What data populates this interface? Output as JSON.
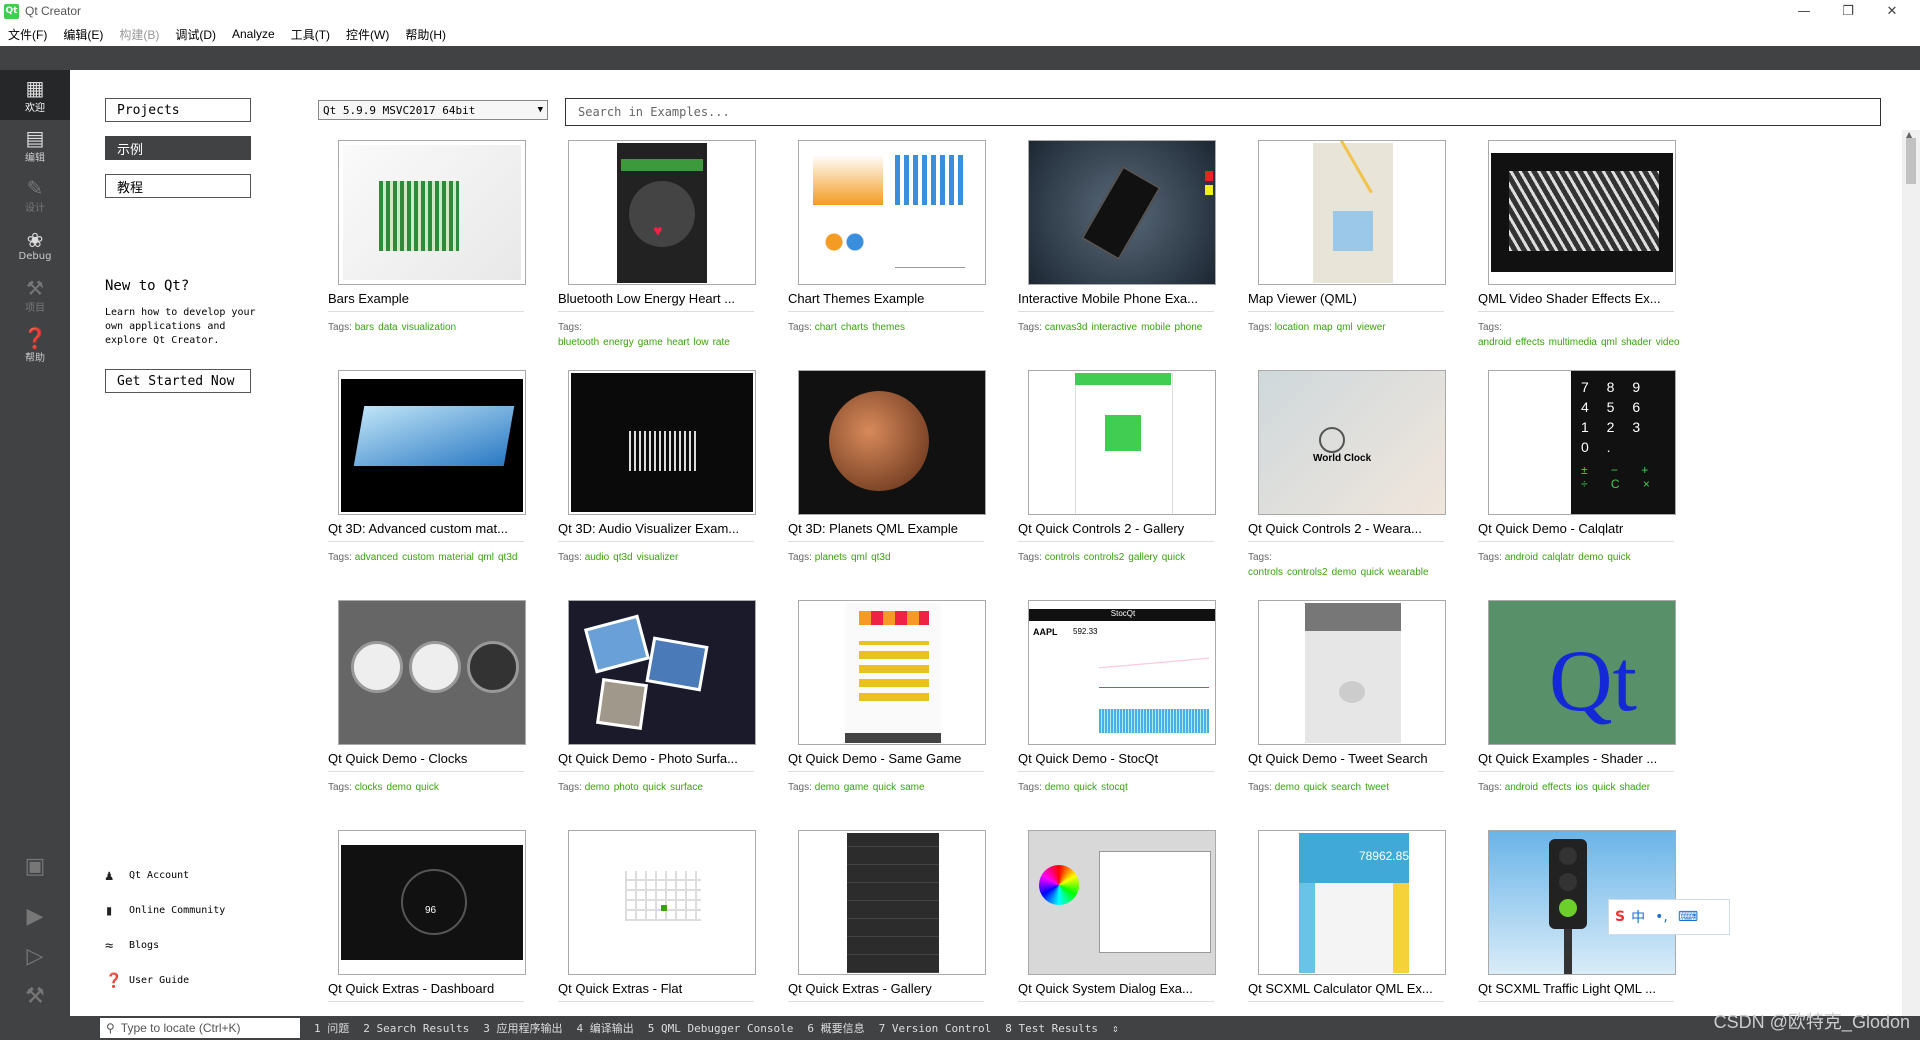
{
  "window": {
    "title": "Qt Creator",
    "logo": "Qt"
  },
  "menu": [
    "文件(F)",
    "编辑(E)",
    "构建(B)",
    "调试(D)",
    "Analyze",
    "工具(T)",
    "控件(W)",
    "帮助(H)"
  ],
  "modes": [
    {
      "label": "欢迎",
      "icon": "grid-icon"
    },
    {
      "label": "编辑",
      "icon": "document-icon"
    },
    {
      "label": "设计",
      "icon": "pencil-icon"
    },
    {
      "label": "Debug",
      "icon": "bug-icon"
    },
    {
      "label": "项目",
      "icon": "wrench-icon"
    },
    {
      "label": "帮助",
      "icon": "help-icon"
    }
  ],
  "sidebar": {
    "projects": "Projects",
    "examples": "示例",
    "tutorials": "教程",
    "new_title": "New to Qt?",
    "new_desc": "Learn how to develop your own applications and explore Qt Creator.",
    "get_started": "Get Started Now",
    "links": [
      "Qt Account",
      "Online Community",
      "Blogs",
      "User Guide"
    ]
  },
  "main": {
    "qt_version": "Qt 5.9.9 MSVC2017 64bit",
    "search_placeholder": "Search in Examples...",
    "tags_label": "Tags:",
    "examples": [
      {
        "title": "Bars Example",
        "tags": [
          "bars",
          "data",
          "visualization"
        ]
      },
      {
        "title": "Bluetooth Low Energy Heart ...",
        "tags": [
          "bluetooth",
          "energy",
          "game",
          "heart",
          "low",
          "rate"
        ]
      },
      {
        "title": "Chart Themes Example",
        "tags": [
          "chart",
          "charts",
          "themes"
        ]
      },
      {
        "title": "Interactive Mobile Phone Exa...",
        "tags": [
          "canvas3d",
          "interactive",
          "mobile",
          "phone"
        ]
      },
      {
        "title": "Map Viewer (QML)",
        "tags": [
          "location",
          "map",
          "qml",
          "viewer"
        ]
      },
      {
        "title": "QML Video Shader Effects Ex...",
        "tags": [
          "android",
          "effects",
          "multimedia",
          "qml",
          "shader",
          "video"
        ]
      },
      {
        "title": "Qt 3D: Advanced custom mat...",
        "tags": [
          "advanced",
          "custom",
          "material",
          "qml",
          "qt3d"
        ]
      },
      {
        "title": "Qt 3D: Audio Visualizer Exam...",
        "tags": [
          "audio",
          "qt3d",
          "visualizer"
        ]
      },
      {
        "title": "Qt 3D: Planets QML Example",
        "tags": [
          "planets",
          "qml",
          "qt3d"
        ]
      },
      {
        "title": "Qt Quick Controls 2 - Gallery",
        "tags": [
          "controls",
          "controls2",
          "gallery",
          "quick"
        ]
      },
      {
        "title": "Qt Quick Controls 2 - Weara...",
        "tags": [
          "controls",
          "controls2",
          "demo",
          "quick",
          "wearable"
        ]
      },
      {
        "title": "Qt Quick Demo - Calqlatr",
        "tags": [
          "android",
          "calqlatr",
          "demo",
          "quick"
        ]
      },
      {
        "title": "Qt Quick Demo - Clocks",
        "tags": [
          "clocks",
          "demo",
          "quick"
        ]
      },
      {
        "title": "Qt Quick Demo - Photo Surfa...",
        "tags": [
          "demo",
          "photo",
          "quick",
          "surface"
        ]
      },
      {
        "title": "Qt Quick Demo - Same Game",
        "tags": [
          "demo",
          "game",
          "quick",
          "same"
        ]
      },
      {
        "title": "Qt Quick Demo - StocQt",
        "tags": [
          "demo",
          "quick",
          "stocqt"
        ]
      },
      {
        "title": "Qt Quick Demo - Tweet Search",
        "tags": [
          "demo",
          "quick",
          "search",
          "tweet"
        ]
      },
      {
        "title": "Qt Quick Examples - Shader ...",
        "tags": [
          "android",
          "effects",
          "ios",
          "quick",
          "shader"
        ]
      },
      {
        "title": "Qt Quick Extras - Dashboard",
        "tags": []
      },
      {
        "title": "Qt Quick Extras - Flat",
        "tags": []
      },
      {
        "title": "Qt Quick Extras - Gallery",
        "tags": []
      },
      {
        "title": "Qt Quick System Dialog Exa...",
        "tags": []
      },
      {
        "title": "Qt SCXML Calculator QML Ex...",
        "tags": []
      },
      {
        "title": "Qt SCXML Traffic Light QML ...",
        "tags": []
      }
    ]
  },
  "thumb_text": {
    "stocqt": "StocQt",
    "aapl": "AAPL",
    "price": "592.33",
    "calc_display": "78962.85",
    "world_clock": "World Clock",
    "dash_speed": "96",
    "qt": "Qt"
  },
  "statusbar": {
    "locator_placeholder": "Type to locate (Ctrl+K)",
    "panes": [
      "1 问题",
      "2 Search Results",
      "3 应用程序输出",
      "4 编译输出",
      "5 QML Debugger Console",
      "6 概要信息",
      "7 Version Control",
      "8 Test Results"
    ]
  },
  "watermark": "CSDN @欧特克_Glodon",
  "ime": {
    "label": "中"
  },
  "colors": {
    "dark": "#404244",
    "accent": "#41cd52",
    "tag": "#3aa30f"
  }
}
